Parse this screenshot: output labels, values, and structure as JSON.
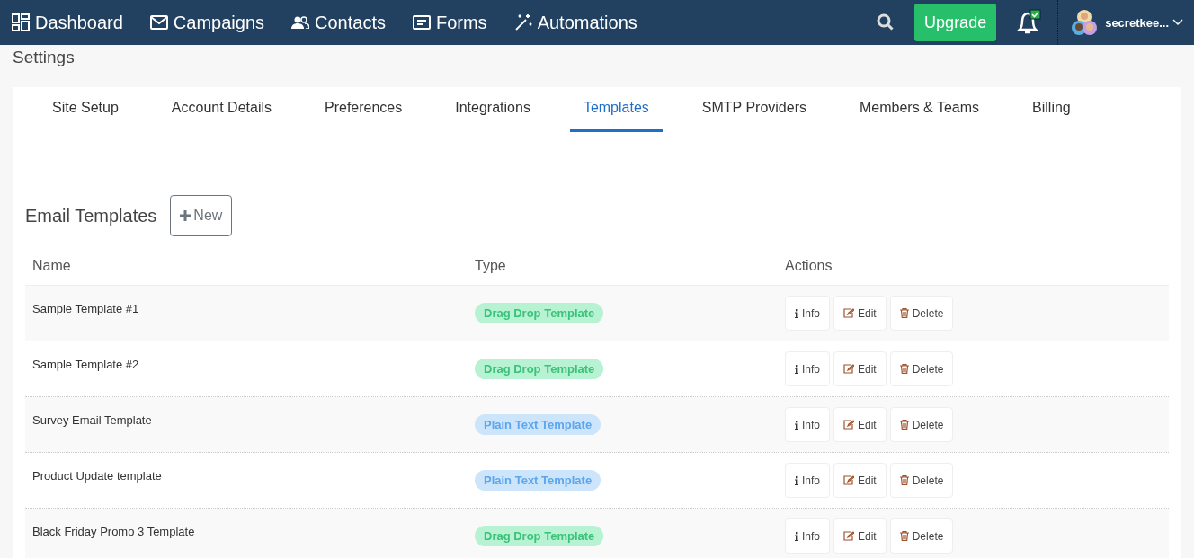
{
  "nav": {
    "items": [
      {
        "label": "Dashboard"
      },
      {
        "label": "Campaigns"
      },
      {
        "label": "Contacts"
      },
      {
        "label": "Forms"
      },
      {
        "label": "Automations"
      }
    ],
    "upgrade": "Upgrade",
    "user": "secretkee..."
  },
  "page_title": "Settings",
  "tabs": [
    {
      "label": "Site Setup",
      "selected": false
    },
    {
      "label": "Account Details",
      "selected": false
    },
    {
      "label": "Preferences",
      "selected": false
    },
    {
      "label": "Integrations",
      "selected": false
    },
    {
      "label": "Templates",
      "selected": true
    },
    {
      "label": "SMTP Providers",
      "selected": false
    },
    {
      "label": "Members & Teams",
      "selected": false
    },
    {
      "label": "Billing",
      "selected": false
    }
  ],
  "section_title": "Email Templates",
  "new_button": "New",
  "table": {
    "columns": [
      "Name",
      "Type",
      "Actions"
    ],
    "rows": [
      {
        "name": "Sample Template #1",
        "type": "Drag Drop Template",
        "kind": "drag",
        "actions": [
          "Info",
          "Edit",
          "Delete"
        ]
      },
      {
        "name": "Sample Template #2",
        "type": "Drag Drop Template",
        "kind": "drag",
        "actions": [
          "Info",
          "Edit",
          "Delete"
        ]
      },
      {
        "name": "Survey Email Template",
        "type": "Plain Text Template",
        "kind": "plain",
        "actions": [
          "Info",
          "Edit",
          "Delete"
        ]
      },
      {
        "name": "Product Update template",
        "type": "Plain Text Template",
        "kind": "plain",
        "actions": [
          "Info",
          "Edit",
          "Delete"
        ]
      },
      {
        "name": "Black Friday Promo 3 Template",
        "type": "Drag Drop Template",
        "kind": "drag",
        "actions": [
          "Info",
          "Edit",
          "Delete"
        ]
      }
    ]
  }
}
